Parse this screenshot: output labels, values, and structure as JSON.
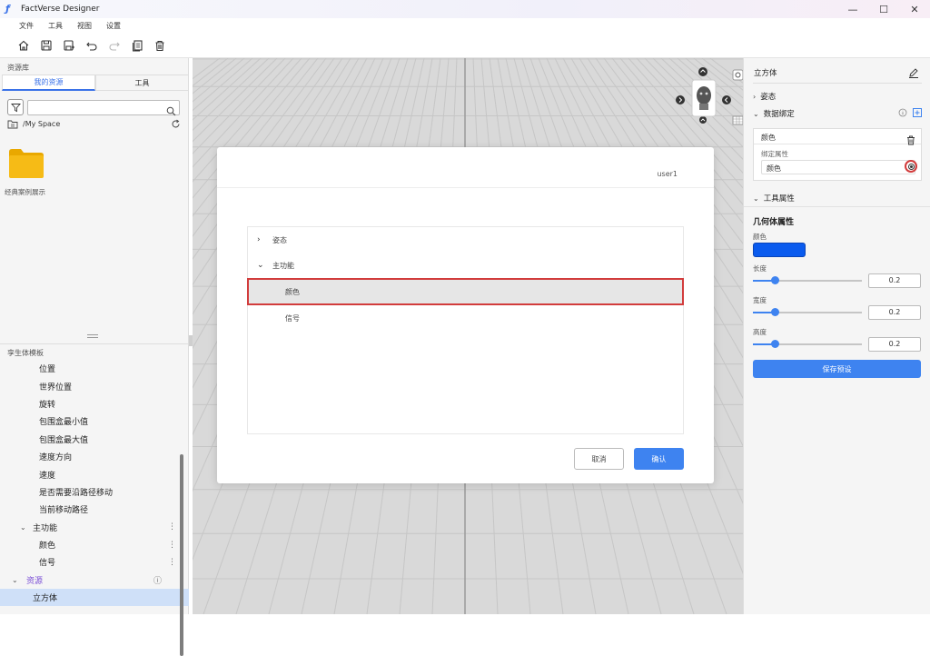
{
  "app": {
    "title": "FactVerse Designer",
    "logo": "logo-icon"
  },
  "window_controls": [
    "minimize-icon",
    "maximize-icon",
    "close-icon"
  ],
  "menu": [
    "文件",
    "工具",
    "视图",
    "设置"
  ],
  "toolbar": [
    "home-icon",
    "save-icon",
    "save-as-icon",
    "undo-icon",
    "redo-icon",
    "copy-icon",
    "delete-icon"
  ],
  "left": {
    "panel_title": "资源库",
    "tabs": [
      "我的资源",
      "工具"
    ],
    "search_placeholder": "",
    "path": "/My Space",
    "folder_label": "经典案例展示",
    "template_title": "孪生体模板",
    "tree": [
      {
        "label": "位置",
        "level": 2
      },
      {
        "label": "世界位置",
        "level": 2
      },
      {
        "label": "旋转",
        "level": 2
      },
      {
        "label": "包围盒最小值",
        "level": 2
      },
      {
        "label": "包围盒最大值",
        "level": 2
      },
      {
        "label": "速度方向",
        "level": 2
      },
      {
        "label": "速度",
        "level": 2
      },
      {
        "label": "是否需要沿路径移动",
        "level": 2
      },
      {
        "label": "当前移动路径",
        "level": 2
      },
      {
        "label": "主功能",
        "level": 1,
        "expanded": true,
        "more": "⋮"
      },
      {
        "label": "颜色",
        "level": 2,
        "more": "⋮"
      },
      {
        "label": "信号",
        "level": 2,
        "more": "⋮"
      },
      {
        "label": "资源",
        "level": 0,
        "expanded": true,
        "info": "ⓘ"
      },
      {
        "label": "立方体",
        "level": 1,
        "selected": true
      }
    ]
  },
  "modal": {
    "user": "user1",
    "items": [
      {
        "label": "姿态",
        "chevron": "›"
      },
      {
        "label": "主功能",
        "chevron": "⌄"
      },
      {
        "label": "颜色",
        "highlighted": true
      },
      {
        "label": "信号"
      }
    ],
    "cancel": "取消",
    "confirm": "确认"
  },
  "right": {
    "title": "立方体",
    "sections": {
      "pose": "姿态",
      "binding": "数据绑定",
      "tool_props": "工具属性"
    },
    "binding_card": {
      "name": "颜色",
      "attr_label": "绑定属性",
      "attr_value": "颜色"
    },
    "geometry_title": "几何体属性",
    "color_label": "颜色",
    "color_value": "#0a5bee",
    "props": [
      {
        "label": "长度",
        "value": "0.2",
        "level": 0.2
      },
      {
        "label": "宽度",
        "value": "0.2",
        "level": 0.2
      },
      {
        "label": "高度",
        "value": "0.2",
        "level": 0.2
      }
    ],
    "save_button": "保存预设"
  },
  "colors": {
    "accent": "#3e83f0",
    "highlight_border": "#d23c3c",
    "selected_bg": "#cfe0f8",
    "purple": "#7b4fd6"
  }
}
